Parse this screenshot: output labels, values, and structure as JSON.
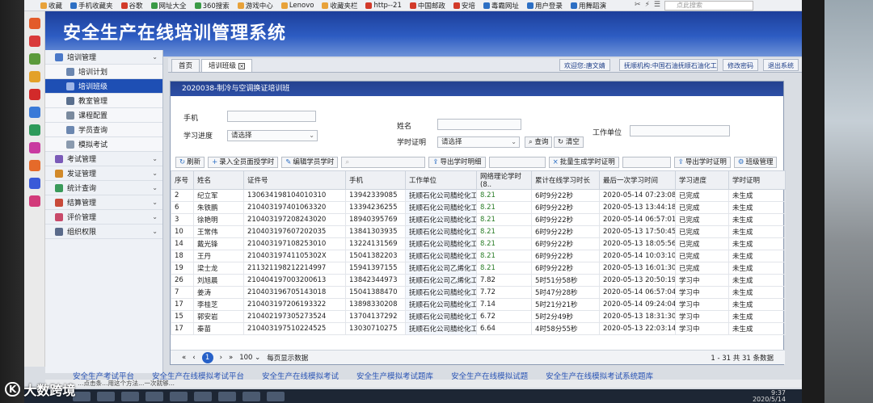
{
  "browser": {
    "bookmarks": [
      "收藏",
      "手机收藏夹",
      "谷歌",
      "网址大全",
      "360搜索",
      "游戏中心",
      "Lenovo",
      "收藏夹栏",
      "http--21",
      "中国邮政",
      "安培",
      "毒霸网址",
      "用户登录",
      "用舞蹈演"
    ],
    "search_placeholder": "点此搜索"
  },
  "app": {
    "title": "安全生产在线培训管理系统"
  },
  "nav": [
    {
      "label": "培训管理",
      "type": "group"
    },
    {
      "label": "培训计划",
      "type": "sub"
    },
    {
      "label": "培训班级",
      "type": "sub",
      "active": true
    },
    {
      "label": "教室管理",
      "type": "sub"
    },
    {
      "label": "课程配置",
      "type": "sub"
    },
    {
      "label": "学员查询",
      "type": "sub"
    },
    {
      "label": "模拟考试",
      "type": "sub"
    },
    {
      "label": "考试管理",
      "type": "group"
    },
    {
      "label": "发证管理",
      "type": "group"
    },
    {
      "label": "统计查询",
      "type": "group"
    },
    {
      "label": "结算管理",
      "type": "group"
    },
    {
      "label": "评价管理",
      "type": "group"
    },
    {
      "label": "组织权限",
      "type": "group"
    }
  ],
  "tabs": [
    {
      "label": "首页"
    },
    {
      "label": "培训班级",
      "active": true
    }
  ],
  "header_user": {
    "welcome": "欢迎您:唐文婧",
    "org": "抚顺机构:中国石油抚顺石油化工有限公司",
    "change_pw": "修改密码",
    "logout": "退出系统"
  },
  "panel": {
    "title": "2020038-制冷与空调换证培训班",
    "filters": {
      "phone_label": "手机",
      "name_label": "姓名",
      "work_unit_label": "工作单位",
      "progress_label": "学习进度",
      "progress_value": "请选择",
      "hours_cert_label": "学时证明",
      "hours_cert_value": "请选择",
      "query_btn": "查询",
      "clear_btn": "清空"
    },
    "toolbar": {
      "refresh": "刷新",
      "enroll": "录入全员面授学时",
      "edit_hours": "编辑学员学时",
      "export_hours": "导出学时明细",
      "batch_gen": "批量生成学时证明",
      "export_cert": "导出学时证明",
      "class_mgmt": "班级管理"
    },
    "columns": [
      "序号",
      "姓名",
      "证件号",
      "手机",
      "工作单位",
      "网络理论学时(8..",
      "累计在线学习时长",
      "最后一次学习时间",
      "学习进度",
      "学时证明"
    ],
    "rows": [
      [
        "2",
        "纪立军",
        "130634198104010310",
        "13942339085",
        "抚顺石化公司腈纶化工厂",
        "8.21",
        "6时9分22秒",
        "2020-05-14 07:23:08",
        "已完成",
        "未生成"
      ],
      [
        "6",
        "朱铁鹏",
        "210403197401063320",
        "13394236255",
        "抚顺石化公司腈纶化工厂",
        "8.21",
        "6时9分22秒",
        "2020-05-13 13:44:18",
        "已完成",
        "未生成"
      ],
      [
        "3",
        "徐艳明",
        "210403197208243020",
        "18940395769",
        "抚顺石化公司腈纶化工厂",
        "8.21",
        "6时9分22秒",
        "2020-05-14 06:57:01",
        "已完成",
        "未生成"
      ],
      [
        "10",
        "王常伟",
        "210403197607202035",
        "13841303935",
        "抚顺石化公司腈纶化工厂",
        "8.21",
        "6时9分22秒",
        "2020-05-13 17:50:45",
        "已完成",
        "未生成"
      ],
      [
        "14",
        "戴光锋",
        "210403197108253010",
        "13224131569",
        "抚顺石化公司腈纶化工厂",
        "8.21",
        "6时9分22秒",
        "2020-05-13 18:05:56",
        "已完成",
        "未生成"
      ],
      [
        "18",
        "王丹",
        "21040319741105302X",
        "15041382203",
        "抚顺石化公司腈纶化工厂",
        "8.21",
        "6时9分22秒",
        "2020-05-14 10:03:10",
        "已完成",
        "未生成"
      ],
      [
        "19",
        "梁士龙",
        "211321198212214997",
        "15941397155",
        "抚顺石化公司乙烯化工厂",
        "8.21",
        "6时9分22秒",
        "2020-05-13 16:01:30",
        "已完成",
        "未生成"
      ],
      [
        "26",
        "刘旭晨",
        "210404197003200613",
        "13842344973",
        "抚顺石化公司乙烯化工厂",
        "7.82",
        "5时51分58秒",
        "2020-05-13 20:50:19",
        "学习中",
        "未生成"
      ],
      [
        "7",
        "姜涛",
        "210403196705143018",
        "15041388470",
        "抚顺石化公司腈纶化工厂",
        "7.72",
        "5时47分28秒",
        "2020-05-14 06:57:04",
        "学习中",
        "未生成"
      ],
      [
        "17",
        "李桂芝",
        "210403197206193322",
        "13898330208",
        "抚顺石化公司腈纶化工厂",
        "7.14",
        "5时21分21秒",
        "2020-05-14 09:24:04",
        "学习中",
        "未生成"
      ],
      [
        "15",
        "郭安岩",
        "210402197305273524",
        "13704137292",
        "抚顺石化公司腈纶化工厂",
        "6.72",
        "5时2分49秒",
        "2020-05-13 18:31:30",
        "学习中",
        "未生成"
      ],
      [
        "17",
        "秦苗",
        "210403197510224525",
        "13030710275",
        "抚顺石化公司腈纶化工厂",
        "6.64",
        "4时58分55秒",
        "2020-05-13 22:03:14",
        "学习中",
        "未生成"
      ]
    ],
    "pager": {
      "current": "1",
      "page_size": "100",
      "page_size_suffix": "每页显示数据",
      "info": "1 - 31 共 31 条数据"
    }
  },
  "footer_links": [
    "安全生产考试平台",
    "安全生产在线模拟考试平台",
    "安全生产在线模拟考试",
    "安全生产模拟考试题库",
    "安全生产在线模拟试题",
    "安全生产在线模拟考试系统题库"
  ],
  "status_bar": "…点击条…用这个方法…一次就够…",
  "taskbar_time": "9:37",
  "taskbar_date": "2020/5/14",
  "watermark": "大数跨境",
  "colors": {
    "header": "#2d5cc2",
    "nav_active": "#1e4fb4",
    "panel_title": "#24418f",
    "link": "#2b55b5"
  }
}
